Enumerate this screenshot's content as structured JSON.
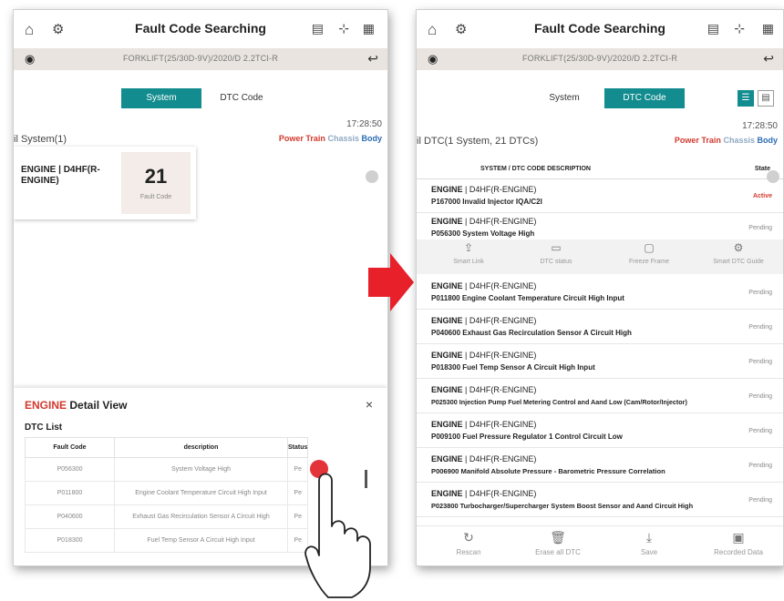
{
  "left": {
    "title": "Fault Code Searching",
    "vehicle": "FORKLIFT(25/30D-9V)/2020/D 2.2TCI-R",
    "tabs": [
      "System",
      "DTC Code"
    ],
    "time": "17:28:50",
    "section_title": "il System(1)",
    "filters": {
      "power_train": "Power Train",
      "chassis": "Chassis",
      "body": "Body"
    },
    "ecu_name": "ENGINE | D4HF(R-ENGINE)",
    "fault_count": "21",
    "fault_count_label": "Fault Code",
    "detail": {
      "title_red": "ENGINE",
      "title_rest": " Detail View",
      "close": "×",
      "list_label": "DTC List",
      "columns": [
        "Fault Code",
        "description",
        "Status"
      ],
      "rows": [
        {
          "code": "P056300",
          "desc": "System Voltage High",
          "status": "Pe"
        },
        {
          "code": "P011800",
          "desc": "Engine Coolant Temperature Circuit High Input",
          "status": "Pe"
        },
        {
          "code": "P040600",
          "desc": "Exhaust Gas Recirculation Sensor A Circuit High",
          "status": "Pe"
        },
        {
          "code": "P018300",
          "desc": "Fuel Temp Sensor A Circuit High Input",
          "status": "Pe"
        }
      ]
    }
  },
  "right": {
    "title": "Fault Code Searching",
    "vehicle": "FORKLIFT(25/30D-9V)/2020/D 2.2TCI-R",
    "tabs": [
      "System",
      "DTC Code"
    ],
    "time": "17:28:50",
    "section_title": "il DTC(1 System, 21 DTCs)",
    "filters": {
      "power_train": "Power Train",
      "chassis": "Chassis",
      "body": "Body"
    },
    "list_header": {
      "desc": "SYSTEM / DTC CODE DESCRIPTION",
      "state": "State"
    },
    "actions": [
      "Smart Link",
      "DTC status",
      "Freeze Frame",
      "Smart DTC Guide"
    ],
    "ecu_prefix": "ENGINE",
    "ecu_suffix": " | D4HF(R-ENGINE)",
    "rows": [
      {
        "code": "P167000 Invalid Injector IQA/C2I",
        "state": "Active"
      },
      {
        "code": "P056300 System Voltage High",
        "state": "Pending"
      },
      {
        "code": "P011800 Engine Coolant Temperature Circuit High Input",
        "state": "Pending"
      },
      {
        "code": "P040600 Exhaust Gas Recirculation Sensor A Circuit High",
        "state": "Pending"
      },
      {
        "code": "P018300 Fuel Temp Sensor A Circuit High Input",
        "state": "Pending"
      },
      {
        "code": "P025300 Injection Pump Fuel Metering Control and Aand Low (Cam/Rotor/Injector)",
        "state": "Pending"
      },
      {
        "code": "P009100 Fuel Pressure Regulator 1 Control Circuit Low",
        "state": "Pending"
      },
      {
        "code": "P006900 Manifold Absolute Pressure - Barometric Pressure Correlation",
        "state": "Pending"
      },
      {
        "code": "P023800 Turbocharger/Supercharger System Boost Sensor and Aand Circuit High",
        "state": "Pending"
      }
    ],
    "bottom": [
      "Rescan",
      "Erase all DTC",
      "Save",
      "Recorded Data"
    ]
  },
  "colors": {
    "teal": "#138c8f",
    "red": "#d23a2f",
    "arrow": "#e8202a"
  }
}
